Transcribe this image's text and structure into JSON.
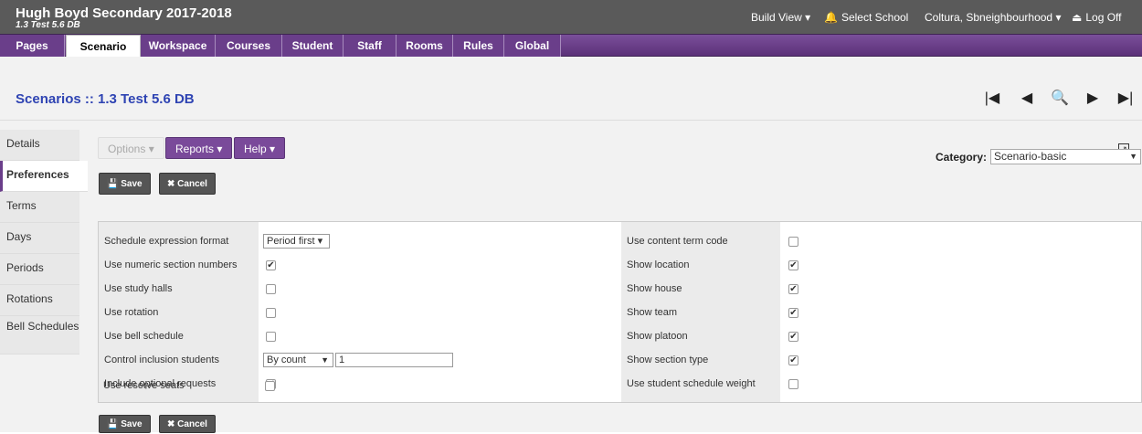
{
  "header": {
    "school": "Hugh Boyd Secondary 2017-2018",
    "subtitle": "1.3 Test 5.6 DB",
    "build_view": "Build View ▾",
    "select_school": "Select School",
    "user": "Coltura, Sbneighbourhood ▾",
    "log_off": "Log Off"
  },
  "tabs": [
    "Pages",
    "Scenario",
    "Workspace",
    "Courses",
    "Student",
    "Staff",
    "Rooms",
    "Rules",
    "Global"
  ],
  "active_tab": "Scenario",
  "page_title": "Scenarios :: 1.3 Test 5.6 DB",
  "nav_controls": {
    "first": "|◀",
    "prev": "◀",
    "search": "🔍",
    "next": "▶",
    "last": "▶|"
  },
  "sidebar": {
    "items": [
      "Details",
      "Preferences",
      "Terms",
      "Days",
      "Periods",
      "Rotations",
      "Bell Schedules"
    ],
    "active": "Preferences"
  },
  "toolbar": {
    "options": "Options ▾",
    "reports": "Reports ▾",
    "help": "Help ▾",
    "save": "Save",
    "cancel": "Cancel"
  },
  "category": {
    "label": "Category:",
    "value": "Scenario-basic"
  },
  "left_prefs": [
    {
      "label": "Schedule expression format",
      "type": "select",
      "value": "Period first ▾"
    },
    {
      "label": "Use numeric section numbers",
      "type": "checkbox",
      "checked": true
    },
    {
      "label": "Use study halls",
      "type": "checkbox",
      "checked": false
    },
    {
      "label": "Use rotation",
      "type": "checkbox",
      "checked": false
    },
    {
      "label": "Use bell schedule",
      "type": "checkbox",
      "checked": false
    },
    {
      "label": "Control inclusion students",
      "type": "select-text",
      "value": "By count",
      "text": "1"
    },
    {
      "label": "Include optional requests",
      "type": "checkbox",
      "checked": true
    },
    {
      "label": "Use reserve seats",
      "type": "checkbox",
      "checked": false
    }
  ],
  "right_prefs": [
    {
      "label": "Use content term code",
      "checked": false
    },
    {
      "label": "Show location",
      "checked": true
    },
    {
      "label": "Show house",
      "checked": true
    },
    {
      "label": "Show team",
      "checked": true
    },
    {
      "label": "Show platoon",
      "checked": true
    },
    {
      "label": "Show section type",
      "checked": true
    },
    {
      "label": "Use student schedule weight",
      "checked": false
    }
  ],
  "icons": {
    "check": "✔",
    "cancel_x": "✖",
    "bell": "🔔",
    "logoff": "⏏",
    "save": "💾",
    "popout": "↗"
  }
}
